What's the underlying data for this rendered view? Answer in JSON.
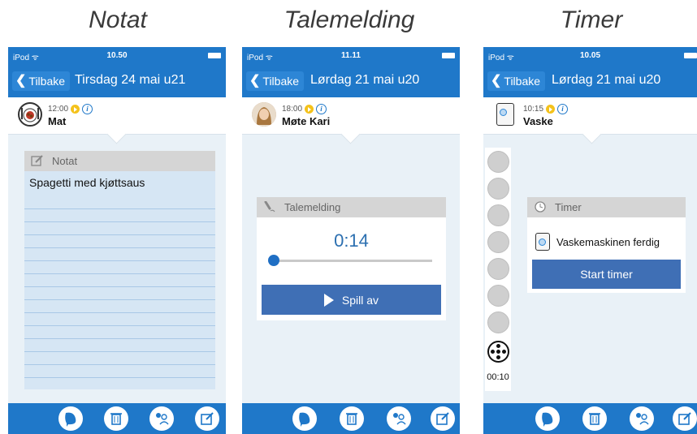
{
  "captions": [
    "Notat",
    "Talemelding",
    "Timer"
  ],
  "colors": {
    "accent": "#1f78c9",
    "button": "#3f6fb5",
    "background": "#e9f1f7"
  },
  "screens": [
    {
      "status": {
        "carrier": "iPod ᯤ",
        "time": "10.50"
      },
      "nav": {
        "back_label": "Tilbake",
        "title": "Tirsdag 24 mai u21"
      },
      "event": {
        "time": "12:00",
        "name": "Mat",
        "icon": "meal-icon"
      },
      "card": {
        "header": "Notat",
        "icon": "note-icon",
        "text": "Spagetti med kjøttsaus"
      }
    },
    {
      "status": {
        "carrier": "iPod ᯤ",
        "time": "11.11"
      },
      "nav": {
        "back_label": "Tilbake",
        "title": "Lørdag 21 mai u20"
      },
      "event": {
        "time": "18:00",
        "name": "Møte Kari",
        "icon": "person-avatar"
      },
      "card": {
        "header": "Talemelding",
        "icon": "microphone-icon",
        "elapsed": "0:14",
        "button_label": "Spill av"
      }
    },
    {
      "status": {
        "carrier": "iPod ᯤ",
        "time": "10.05"
      },
      "nav": {
        "back_label": "Tilbake",
        "title": "Lørdag 21 mai u20"
      },
      "event": {
        "time": "10:15",
        "name": "Vaske",
        "icon": "washing-machine-icon"
      },
      "card": {
        "header": "Timer",
        "icon": "clock-icon",
        "label": "Vaskemaskinen ferdig",
        "button_label": "Start timer"
      },
      "timer_readout": "00:10"
    }
  ],
  "tabbar_icons": [
    "speak-icon",
    "trash-icon",
    "contacts-icon",
    "edit-icon"
  ]
}
